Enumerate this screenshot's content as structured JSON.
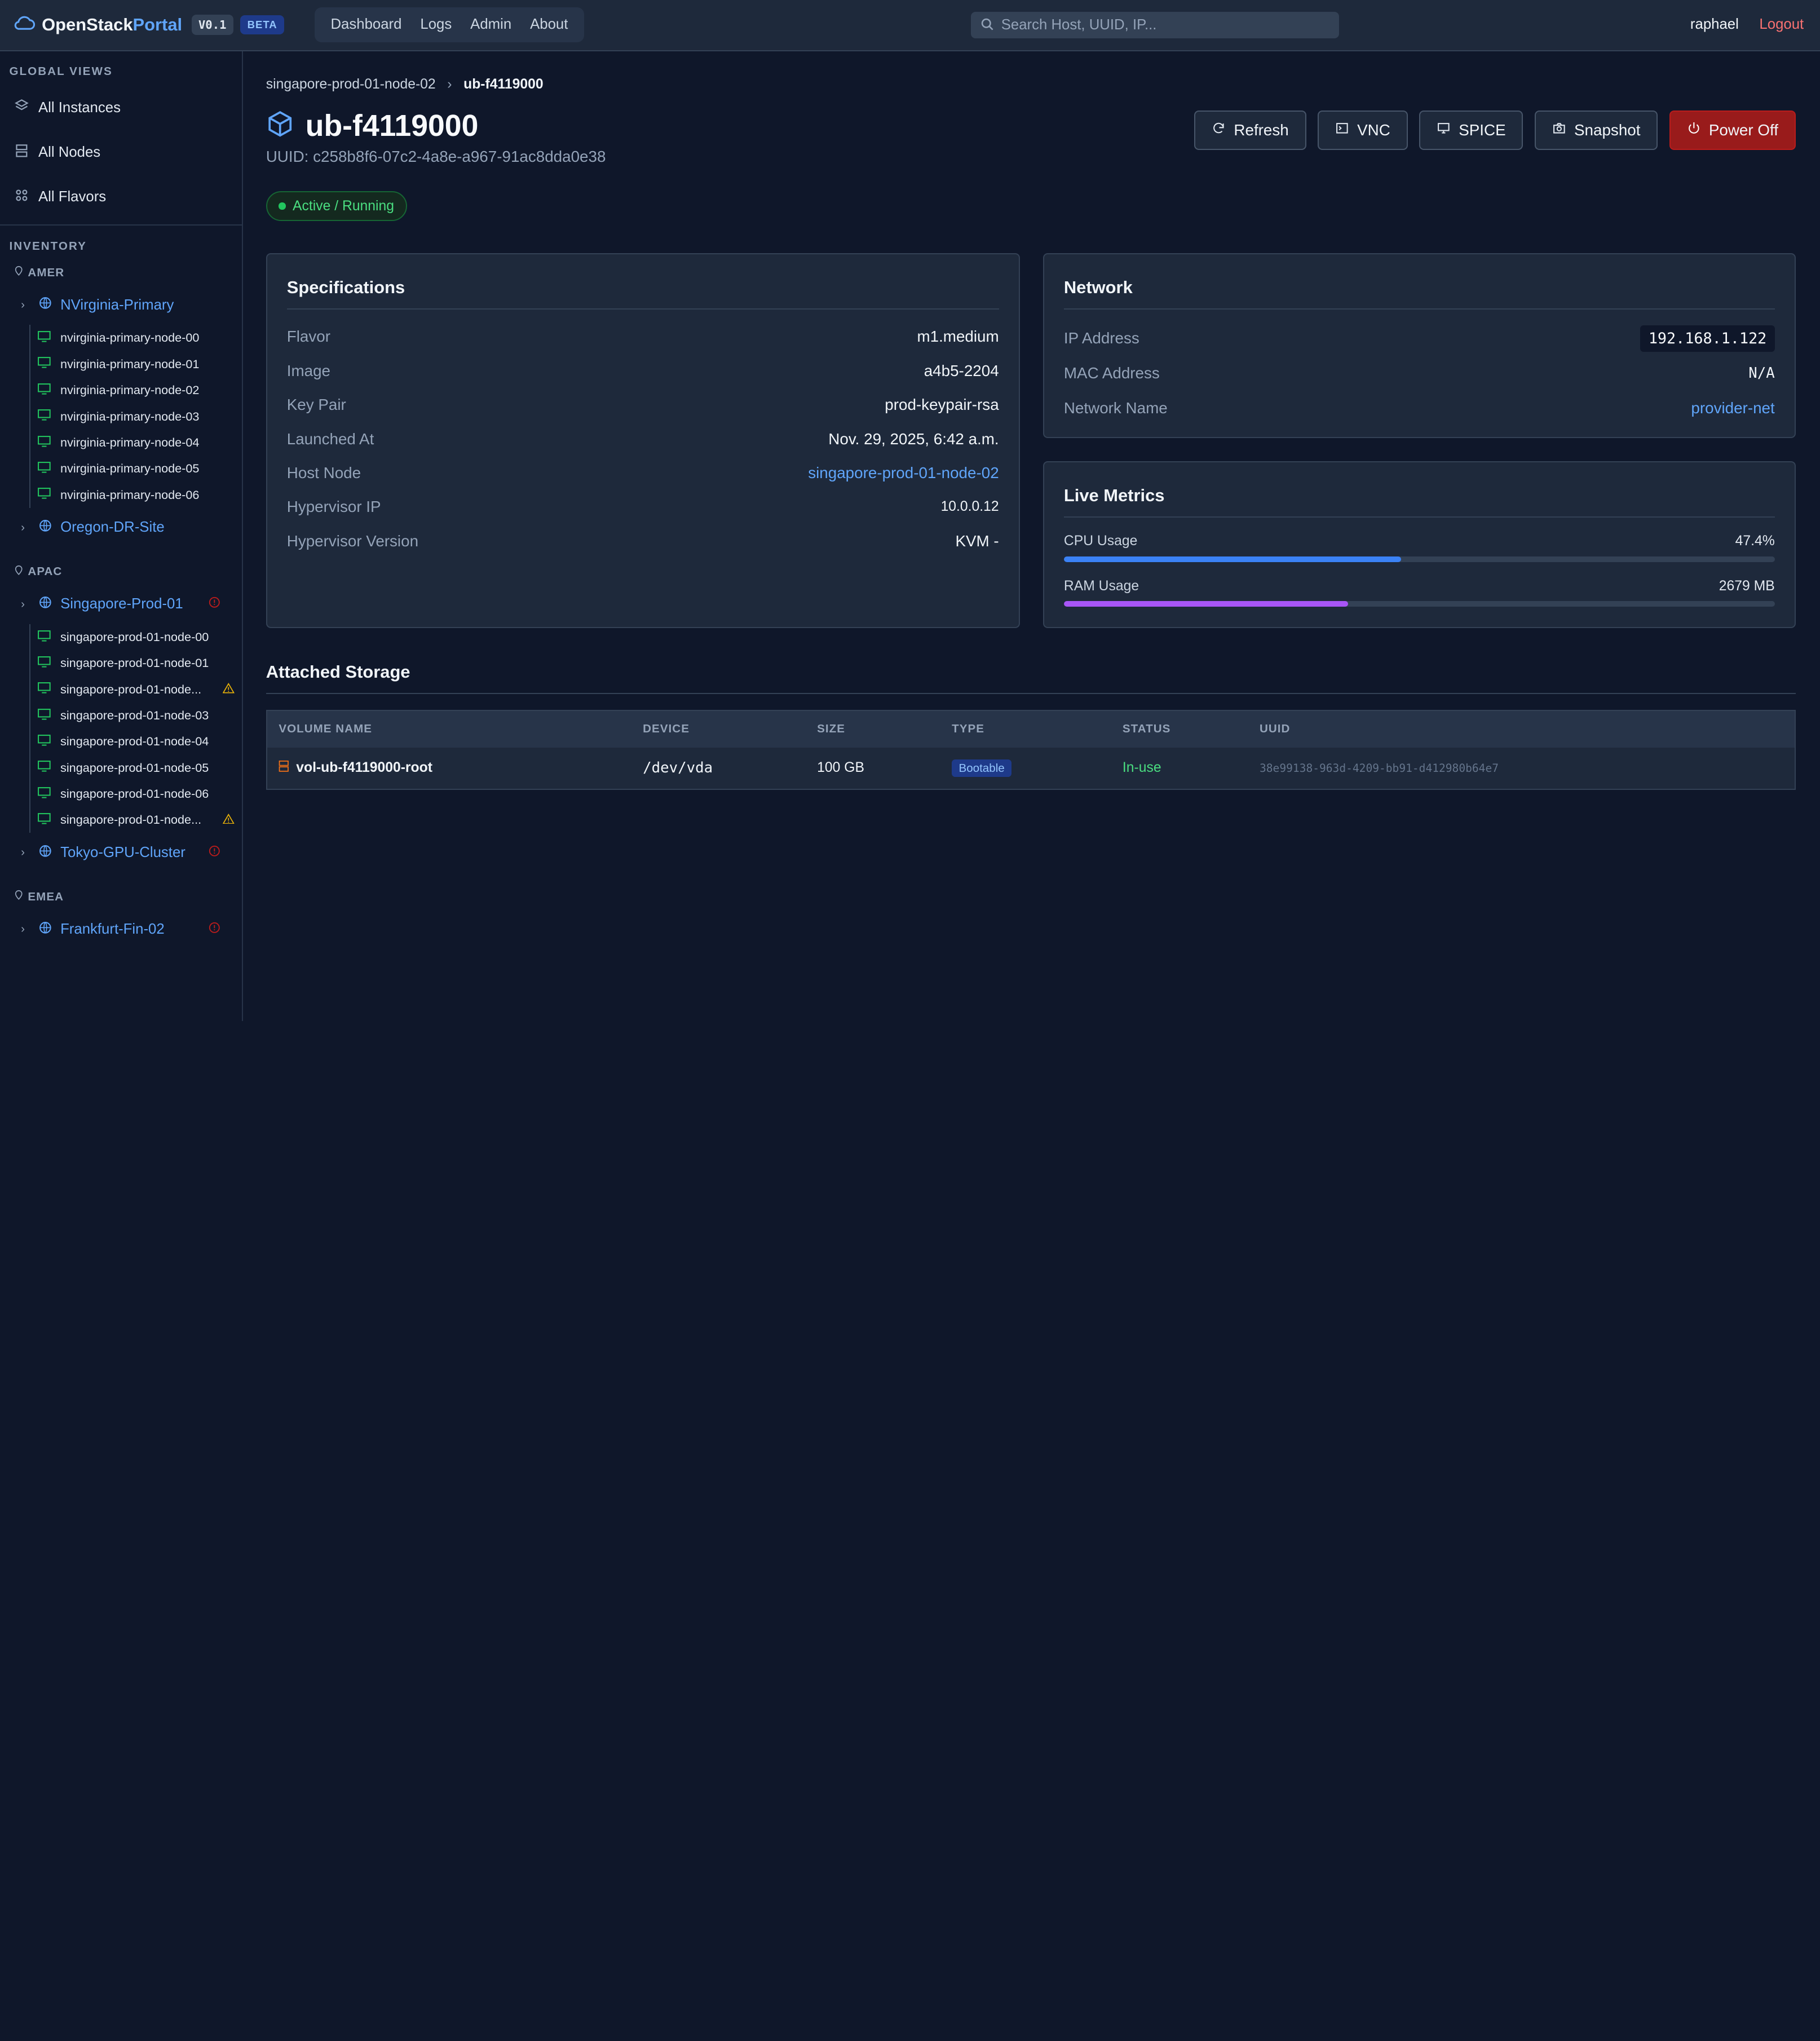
{
  "header": {
    "brand_main": "OpenStack",
    "brand_accent": "Portal",
    "version": "V0.1",
    "beta": "BETA",
    "nav": [
      "Dashboard",
      "Logs",
      "Admin",
      "About"
    ],
    "search_placeholder": "Search Host, UUID, IP...",
    "user": "raphael",
    "logout": "Logout"
  },
  "sidebar": {
    "global_title": "GLOBAL VIEWS",
    "global_items": [
      "All Instances",
      "All Nodes",
      "All Flavors"
    ],
    "inventory_title": "INVENTORY",
    "regions": [
      {
        "name": "AMER",
        "sites": [
          {
            "name": "NVirginia-Primary",
            "alert": false,
            "nodes": [
              {
                "name": "nvirginia-primary-node-00",
                "warn": false
              },
              {
                "name": "nvirginia-primary-node-01",
                "warn": false
              },
              {
                "name": "nvirginia-primary-node-02",
                "warn": false
              },
              {
                "name": "nvirginia-primary-node-03",
                "warn": false
              },
              {
                "name": "nvirginia-primary-node-04",
                "warn": false
              },
              {
                "name": "nvirginia-primary-node-05",
                "warn": false
              },
              {
                "name": "nvirginia-primary-node-06",
                "warn": false
              }
            ]
          },
          {
            "name": "Oregon-DR-Site",
            "alert": false,
            "nodes": []
          }
        ]
      },
      {
        "name": "APAC",
        "sites": [
          {
            "name": "Singapore-Prod-01",
            "alert": true,
            "nodes": [
              {
                "name": "singapore-prod-01-node-00",
                "warn": false
              },
              {
                "name": "singapore-prod-01-node-01",
                "warn": false
              },
              {
                "name": "singapore-prod-01-node...",
                "warn": true
              },
              {
                "name": "singapore-prod-01-node-03",
                "warn": false
              },
              {
                "name": "singapore-prod-01-node-04",
                "warn": false
              },
              {
                "name": "singapore-prod-01-node-05",
                "warn": false
              },
              {
                "name": "singapore-prod-01-node-06",
                "warn": false
              },
              {
                "name": "singapore-prod-01-node...",
                "warn": true
              }
            ]
          },
          {
            "name": "Tokyo-GPU-Cluster",
            "alert": true,
            "nodes": []
          }
        ]
      },
      {
        "name": "EMEA",
        "sites": [
          {
            "name": "Frankfurt-Fin-02",
            "alert": true,
            "nodes": []
          }
        ]
      }
    ]
  },
  "breadcrumb": {
    "parent": "singapore-prod-01-node-02",
    "current": "ub-f4119000"
  },
  "instance": {
    "name": "ub-f4119000",
    "uuid_label": "UUID: c258b8f6-07c2-4a8e-a967-91ac8dda0e38",
    "status": "Active / Running"
  },
  "actions": [
    "Refresh",
    "VNC",
    "SPICE",
    "Snapshot",
    "Power Off"
  ],
  "specs": {
    "title": "Specifications",
    "rows": [
      {
        "k": "Flavor",
        "v": "m1.medium"
      },
      {
        "k": "Image",
        "v": "a4b5-2204"
      },
      {
        "k": "Key Pair",
        "v": "prod-keypair-rsa"
      },
      {
        "k": "Launched At",
        "v": "Nov. 29, 2025, 6:42 a.m."
      },
      {
        "k": "Host Node",
        "v": "singapore-prod-01-node-02"
      },
      {
        "k": "Hypervisor IP",
        "v": "10.0.0.12"
      },
      {
        "k": "Hypervisor Version",
        "v": "KVM -"
      }
    ]
  },
  "network": {
    "title": "Network",
    "ip_label": "IP Address",
    "ip": "192.168.1.122",
    "mac_label": "MAC Address",
    "mac": "N/A",
    "net_label": "Network Name",
    "net": "provider-net"
  },
  "metrics": {
    "title": "Live Metrics",
    "cpu_label": "CPU Usage",
    "cpu_value": "47.4%",
    "cpu_fraction": 0.474,
    "ram_label": "RAM Usage",
    "ram_value": "2679 MB",
    "ram_fraction": 0.4,
    "cpu_color": "#3b82f6",
    "ram_color": "#a855f7"
  },
  "storage": {
    "title": "Attached Storage",
    "columns": [
      "VOLUME NAME",
      "DEVICE",
      "SIZE",
      "TYPE",
      "STATUS",
      "UUID"
    ],
    "rows": [
      {
        "name": "vol-ub-f4119000-root",
        "device": "/dev/vda",
        "size": "100 GB",
        "type": "Bootable",
        "status": "In-use",
        "uuid": "38e99138-963d-4209-bb91-d412980b64e7"
      }
    ]
  }
}
